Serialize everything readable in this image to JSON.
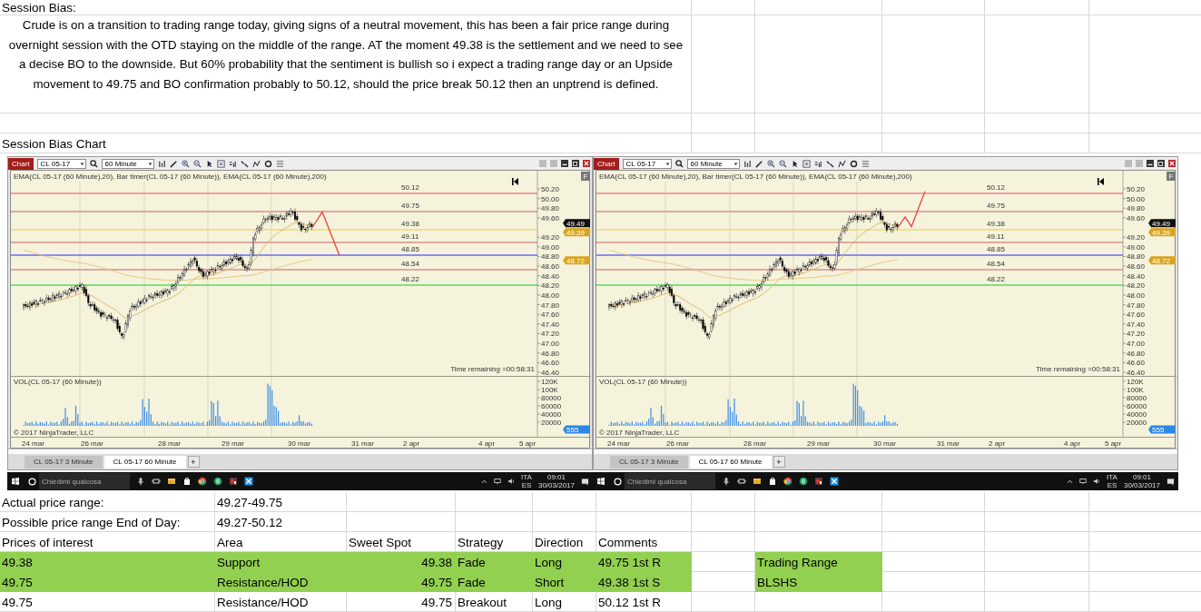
{
  "sheet": {
    "title": "Session Bias:",
    "bias_text": "Crude is on a transition to trading range today, giving signs of a neutral movement, this has been a fair price range during overnight session with the OTD staying on the middle of the range. AT the moment 49.38 is the settlement and we need to see a decise BO to the downside. But 60% probability that the sentiment is bullish so i expect a trading range day or an Upside movement to 49.75 and BO confirmation probably to 50.12, should the price break 50.12 then an unptrend is defined.",
    "chart_label": "Session Bias Chart"
  },
  "screens": [
    {
      "toolbar": {
        "title": "Chart",
        "instrument": "CL 05-17",
        "interval": "60 Minute"
      },
      "scale_button": "F",
      "indicator_label": "EMA(CL 05-17 (60 Minute),20), Bar timer(CL 05-17 (60 Minute)), EMA(CL 05-17 (60 Minute),200)",
      "levels": [
        {
          "label": "50.12",
          "color": "#f2a0a0"
        },
        {
          "label": "49.75",
          "color": "#e0a8a0"
        },
        {
          "label": "49.38",
          "color": "#f0e090"
        },
        {
          "label": "49.11",
          "color": "#e0a8a0"
        },
        {
          "label": "48.85",
          "color": "#8c8cf0"
        },
        {
          "label": "48.54",
          "color": "#e0a8a0"
        },
        {
          "label": "48.22",
          "color": "#80e080"
        }
      ],
      "price_ticks": [
        "50.20",
        "50.00",
        "49.80",
        "49.60",
        "49.20",
        "49.00",
        "48.80",
        "48.60",
        "48.40",
        "48.20",
        "48.00",
        "47.80",
        "47.60",
        "47.40",
        "47.20",
        "47.00",
        "46.80",
        "46.60",
        "46.40"
      ],
      "projection": {
        "kind": "down"
      },
      "price_badges": [
        {
          "text": "49.49",
          "color": "#101010"
        },
        {
          "text": "49.39",
          "color": "#d9a520"
        },
        {
          "text": "48.72",
          "color": "#d9a520"
        }
      ],
      "time_remaining": "Time remaining =00:58:31",
      "volume_label": "VOL(CL 05-17 (60 Minute))",
      "volume_ticks": [
        "120K",
        "100K",
        "80000",
        "60000",
        "40000",
        "20000"
      ],
      "volume_badge": "555",
      "copyright": "© 2017 NinjaTrader, LLC",
      "dates": [
        "24 mar",
        "26 mar",
        "28 mar",
        "29 mar",
        "30 mar",
        "31 mar",
        "2 apr",
        "4 apr",
        "5 apr"
      ],
      "tabs": [
        {
          "label": "CL 05-17 3 Minute",
          "selected": false
        },
        {
          "label": "CL 05-17 60 Minute",
          "selected": true
        }
      ],
      "add_tab": "+",
      "taskbar": {
        "search_placeholder": "Chiedimi qualcosa",
        "language": "ITA",
        "layout": "ES",
        "time": "09:01",
        "date": "30/03/2017"
      }
    },
    {
      "toolbar": {
        "title": "Chart",
        "instrument": "CL 05-17",
        "interval": "60 Minute"
      },
      "scale_button": "F",
      "indicator_label": "EMA(CL 05-17 (60 Minute),20), Bar timer(CL 05-17 (60 Minute)), EMA(CL 05-17 (60 Minute),200)",
      "levels": [
        {
          "label": "50.12",
          "color": "#f2a0a0"
        },
        {
          "label": "49.75",
          "color": "#e0a8a0"
        },
        {
          "label": "49.38",
          "color": "#f0e090"
        },
        {
          "label": "49.11",
          "color": "#e0a8a0"
        },
        {
          "label": "48.85",
          "color": "#8c8cf0"
        },
        {
          "label": "48.54",
          "color": "#e0a8a0"
        },
        {
          "label": "48.22",
          "color": "#80e080"
        }
      ],
      "price_ticks": [
        "50.20",
        "50.00",
        "49.80",
        "49.60",
        "49.20",
        "49.00",
        "48.80",
        "48.60",
        "48.40",
        "48.20",
        "48.00",
        "47.80",
        "47.60",
        "47.40",
        "47.20",
        "47.00",
        "46.80",
        "46.60",
        "46.40"
      ],
      "projection": {
        "kind": "up"
      },
      "price_badges": [
        {
          "text": "49.49",
          "color": "#101010"
        },
        {
          "text": "49.39",
          "color": "#d9a520"
        },
        {
          "text": "48.72",
          "color": "#d9a520"
        }
      ],
      "time_remaining": "Time remaining =00:58:31",
      "volume_label": "VOL(CL 05-17 (60 Minute))",
      "volume_ticks": [
        "120K",
        "100K",
        "80000",
        "60000",
        "40000",
        "20000"
      ],
      "volume_badge": "555",
      "copyright": "© 2017 NinjaTrader, LLC",
      "dates": [
        "24 mar",
        "26 mar",
        "28 mar",
        "29 mar",
        "30 mar",
        "31 mar",
        "2 apr",
        "4 apr",
        "5 apr"
      ],
      "tabs": [
        {
          "label": "CL 05-17 3 Minute",
          "selected": false
        },
        {
          "label": "CL 05-17 60 Minute",
          "selected": true
        }
      ],
      "add_tab": "+",
      "taskbar": {
        "search_placeholder": "Chiedimi qualcosa",
        "language": "ITA",
        "layout": "ES",
        "time": "09:01",
        "date": "30/03/2017"
      }
    }
  ],
  "table": {
    "info_rows": [
      {
        "label": "Actual price range:",
        "value": "49.27-49.75"
      },
      {
        "label": "Possible price range End of Day:",
        "value": "49.27-50.12"
      }
    ],
    "columns": [
      "Prices of interest",
      "Area",
      "Sweet Spot",
      "Strategy",
      "Direction",
      "Comments"
    ],
    "rows": [
      {
        "price": "49.38",
        "area": "Support",
        "sweet_spot": "49.38",
        "strategy": "Fade",
        "direction": "Long",
        "comment": "49.75 1st R",
        "highlighted": true,
        "note": {
          "text": "Trading Range",
          "highlighted": true
        }
      },
      {
        "price": "49.75",
        "area": "Resistance/HOD",
        "sweet_spot": "49.75",
        "strategy": "Fade",
        "direction": "Short",
        "comment": "49.38 1st S",
        "highlighted": true,
        "note": {
          "text": "BLSHS",
          "highlighted": true
        }
      },
      {
        "price": "49.75",
        "area": "Resistance/HOD",
        "sweet_spot": "49.75",
        "strategy": "Breakout",
        "direction": "Long",
        "comment": "50.12 1st R",
        "highlighted": false
      }
    ]
  }
}
